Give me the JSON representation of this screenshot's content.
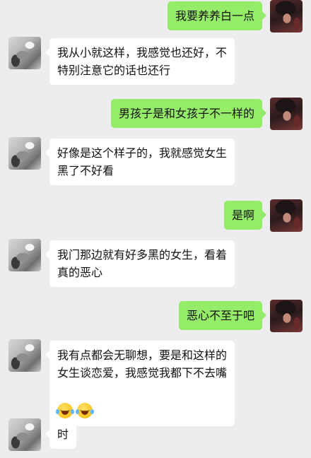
{
  "messages": [
    {
      "sender": "self",
      "text": "我要养养白一点"
    },
    {
      "sender": "other",
      "text": "我从小就这样，我感觉也还好，不\n特别注意它的话也还行"
    },
    {
      "sender": "self",
      "text": "男孩子是和女孩子不一样的"
    },
    {
      "sender": "other",
      "text": "好像是这个样子的，我就感觉女生\n黑了不好看"
    },
    {
      "sender": "self",
      "text": "是啊"
    },
    {
      "sender": "other",
      "text": "我门那边就有好多黑的女生，看着\n真的恶心"
    },
    {
      "sender": "self",
      "text": "恶心不至于吧"
    },
    {
      "sender": "other",
      "text": "我有点都会无聊想，要是和这样的\n女生谈恋爱，我感觉我都下不去嘴",
      "emoji": [
        "laughing-tears-emoji",
        "laughing-tears-emoji"
      ]
    },
    {
      "sender": "other",
      "text": "时"
    }
  ],
  "colors": {
    "background": "#ededed",
    "self_bubble": "#95ec69",
    "other_bubble": "#ffffff"
  }
}
